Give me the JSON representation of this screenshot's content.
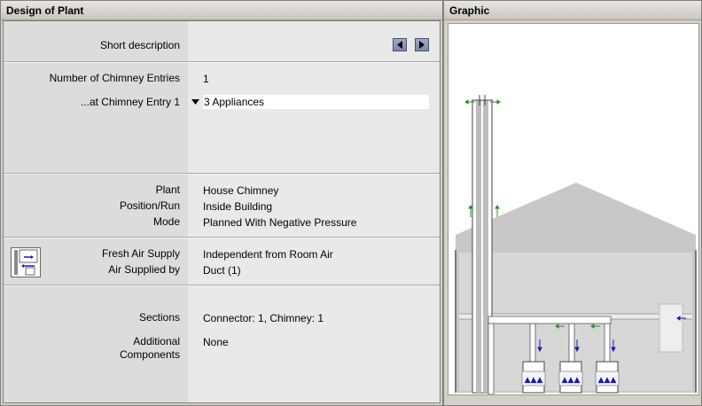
{
  "left_panel": {
    "title": "Design of Plant",
    "short_description_label": "Short description",
    "chimney_entries_label": "Number of Chimney Entries",
    "chimney_entries_value": "1",
    "chimney_entry_label": "...at Chimney Entry 1",
    "chimney_entry_value": "3 Appliances",
    "plant_label": "Plant",
    "plant_value": "House Chimney",
    "position_label": "Position/Run",
    "position_value": "Inside Building",
    "mode_label": "Mode",
    "mode_value": "Planned With Negative Pressure",
    "fresh_air_label": "Fresh Air Supply",
    "fresh_air_value": "Independent from Room Air",
    "air_supplied_label": "Air Supplied by",
    "air_supplied_value": "Duct (1)",
    "sections_label": "Sections",
    "sections_value": "Connector: 1, Chimney: 1",
    "additional_label_1": "Additional",
    "additional_label_2": "Components",
    "additional_value": "None"
  },
  "right_panel": {
    "title": "Graphic"
  },
  "colors": {
    "panel_bg": "#d4d0c8",
    "label_col": "#dcdcdc",
    "value_col": "#e9e9e9",
    "nav_button": "#8890b8",
    "flow_arrow_green": "#2e8b2e",
    "flow_arrow_blue": "#1a1aa8",
    "roof": "#c8c8c8"
  },
  "icons": {
    "prev": "triangle-left-icon",
    "next": "triangle-right-icon",
    "dropdown": "triangle-down-icon",
    "fresh_air": "fresh-air-supply-icon",
    "appliance": "boiler-icon"
  }
}
